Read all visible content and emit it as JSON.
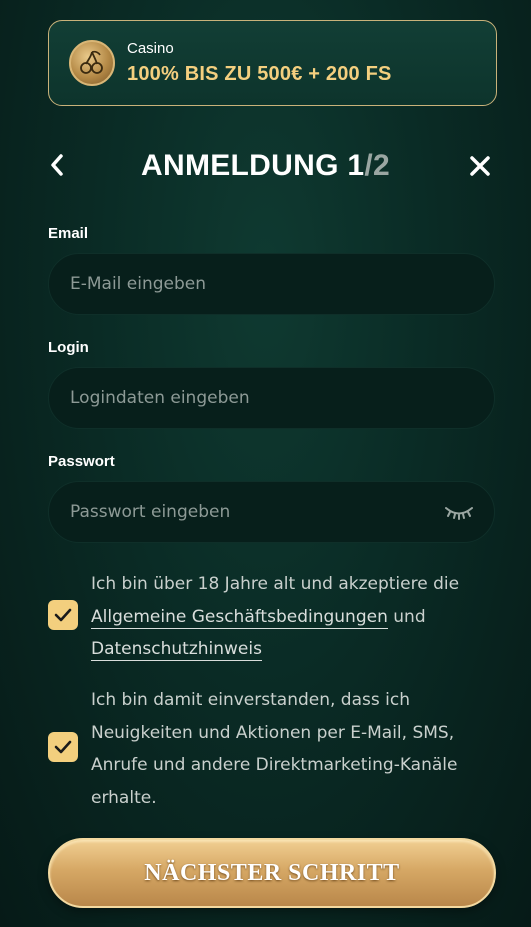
{
  "promo": {
    "label": "Casino",
    "bonus": "100% BIS ZU 500€ + 200 FS",
    "logo_icon": "cherry-icon"
  },
  "header": {
    "title_main": "ANMELDUNG 1",
    "title_total": "/2",
    "back_icon": "chevron-left-icon",
    "close_icon": "close-icon"
  },
  "form": {
    "email": {
      "label": "Email",
      "placeholder": "E-Mail eingeben",
      "value": ""
    },
    "login": {
      "label": "Login",
      "placeholder": "Logindaten eingeben",
      "value": ""
    },
    "password": {
      "label": "Passwort",
      "placeholder": "Passwort eingeben",
      "value": "",
      "toggle_icon": "eye-closed-icon"
    }
  },
  "consents": {
    "terms": {
      "checked": true,
      "text_before": "Ich bin über 18 Jahre alt und akzeptiere die",
      "link_terms": "Allgemeine Geschäftsbedingungen",
      "text_and": "und",
      "link_privacy": "Datenschutzhinweis"
    },
    "marketing": {
      "checked": true,
      "text": "Ich bin damit einverstanden, dass ich Neuigkeiten und Aktionen per E-Mail, SMS, Anrufe und andere Direktmarketing-Kanäle erhalte."
    }
  },
  "actions": {
    "next_label": "NÄCHSTER SCHRITT"
  },
  "colors": {
    "accent_gold": "#f3cf7e",
    "background": "#0a2b25",
    "field_bg": "#071f1b"
  }
}
